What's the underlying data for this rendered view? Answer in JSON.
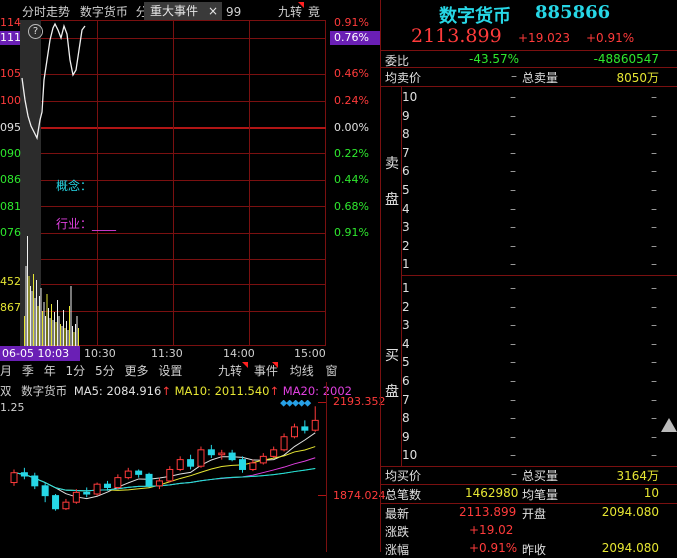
{
  "header": {
    "name": "数字货币",
    "code": "885866",
    "price": "2113.899",
    "change": "+19.023",
    "pct": "+0.91%"
  },
  "intraday": {
    "tab_label": "分时走势",
    "title": "数字货币",
    "fen": "分",
    "event_tab": "重大事件",
    "close_glyph": "×",
    "num": "99",
    "jiuzhuan": "九转",
    "jing": "竟",
    "left_axis": [
      "114",
      "111",
      "105",
      "100",
      "095",
      "090",
      "086",
      "081",
      "076",
      "452",
      "867",
      ""
    ],
    "right_axis": [
      "0.91%",
      "0.76%",
      "0.46%",
      "0.24%",
      "0.00%",
      "0.22%",
      "0.44%",
      "0.68%",
      "0.91%"
    ],
    "concept_label": "概念：",
    "industry_label": "行业：____",
    "time_labels": [
      "06-05 10:03",
      "10:30",
      "11:30",
      "14:00",
      "15:00"
    ],
    "help_glyph": "?"
  },
  "kline": {
    "tabs": [
      "月",
      "季",
      "年",
      "1分",
      "5分",
      "更多",
      "设置"
    ],
    "right_tabs": [
      "九转",
      "事件",
      "均线",
      "窗"
    ],
    "ma_prefix": "双",
    "ma_title": "数字货币",
    "ma5": "MA5: 2084.916",
    "ma10": "MA10: 2011.540",
    "ma20": "MA20: 2002",
    "left_value": "1.25",
    "high_price": "2193.352",
    "low_price": "1874.024",
    "candles": [
      {
        "o": 1960,
        "c": 1990,
        "h": 2000,
        "l": 1950
      },
      {
        "o": 1990,
        "c": 1980,
        "h": 2005,
        "l": 1970
      },
      {
        "o": 1980,
        "c": 1950,
        "h": 1990,
        "l": 1940
      },
      {
        "o": 1950,
        "c": 1920,
        "h": 1960,
        "l": 1900
      },
      {
        "o": 1920,
        "c": 1880,
        "h": 1925,
        "l": 1874
      },
      {
        "o": 1880,
        "c": 1900,
        "h": 1910,
        "l": 1876
      },
      {
        "o": 1900,
        "c": 1930,
        "h": 1940,
        "l": 1895
      },
      {
        "o": 1930,
        "c": 1925,
        "h": 1945,
        "l": 1915
      },
      {
        "o": 1925,
        "c": 1955,
        "h": 1960,
        "l": 1920
      },
      {
        "o": 1955,
        "c": 1945,
        "h": 1965,
        "l": 1935
      },
      {
        "o": 1945,
        "c": 1975,
        "h": 1985,
        "l": 1940
      },
      {
        "o": 1975,
        "c": 1995,
        "h": 2005,
        "l": 1970
      },
      {
        "o": 1995,
        "c": 1985,
        "h": 2000,
        "l": 1975
      },
      {
        "o": 1985,
        "c": 1950,
        "h": 1990,
        "l": 1945
      },
      {
        "o": 1950,
        "c": 1965,
        "h": 1975,
        "l": 1940
      },
      {
        "o": 1965,
        "c": 2000,
        "h": 2010,
        "l": 1960
      },
      {
        "o": 2000,
        "c": 2030,
        "h": 2040,
        "l": 1995
      },
      {
        "o": 2030,
        "c": 2010,
        "h": 2045,
        "l": 2000
      },
      {
        "o": 2010,
        "c": 2060,
        "h": 2070,
        "l": 2005
      },
      {
        "o": 2060,
        "c": 2045,
        "h": 2075,
        "l": 2035
      },
      {
        "o": 2045,
        "c": 2050,
        "h": 2060,
        "l": 2030
      },
      {
        "o": 2050,
        "c": 2030,
        "h": 2060,
        "l": 2025
      },
      {
        "o": 2030,
        "c": 2000,
        "h": 2040,
        "l": 1990
      },
      {
        "o": 2000,
        "c": 2020,
        "h": 2030,
        "l": 1995
      },
      {
        "o": 2020,
        "c": 2040,
        "h": 2050,
        "l": 2015
      },
      {
        "o": 2040,
        "c": 2060,
        "h": 2070,
        "l": 2035
      },
      {
        "o": 2060,
        "c": 2100,
        "h": 2110,
        "l": 2055
      },
      {
        "o": 2100,
        "c": 2130,
        "h": 2140,
        "l": 2095
      },
      {
        "o": 2130,
        "c": 2120,
        "h": 2150,
        "l": 2110
      },
      {
        "o": 2120,
        "c": 2150,
        "h": 2193,
        "l": 2115
      }
    ]
  },
  "orderbook": {
    "weibi_label": "委比",
    "weibi_pct": "-43.57%",
    "weibi_val": "-48860547",
    "avg_sell_label": "均卖价",
    "avg_sell_val": "–",
    "total_sell_label": "总卖量",
    "total_sell_val": "8050万",
    "sell_side_label": "卖",
    "sell_side_label2": "盘",
    "buy_side_label": "买",
    "buy_side_label2": "盘",
    "sell_levels": [
      "10",
      "9",
      "8",
      "7",
      "6",
      "5",
      "4",
      "3",
      "2",
      "1"
    ],
    "buy_levels": [
      "1",
      "2",
      "3",
      "4",
      "5",
      "6",
      "7",
      "8",
      "9",
      "10"
    ],
    "dash": "–",
    "avg_buy_label": "均买价",
    "avg_buy_val": "–",
    "total_buy_label": "总买量",
    "total_buy_val": "3164万",
    "total_trades_label": "总笔数",
    "total_trades_val": "1462980",
    "avg_trade_label": "均笔量",
    "avg_trade_val": "10",
    "latest_label": "最新",
    "latest_val": "2113.899",
    "open_label": "开盘",
    "open_val": "2094.080",
    "change_label": "涨跌",
    "change_val": "+19.02",
    "pct_label": "涨幅",
    "pct_val": "+0.91%",
    "prev_label": "昨收",
    "prev_val": "2094.080"
  }
}
